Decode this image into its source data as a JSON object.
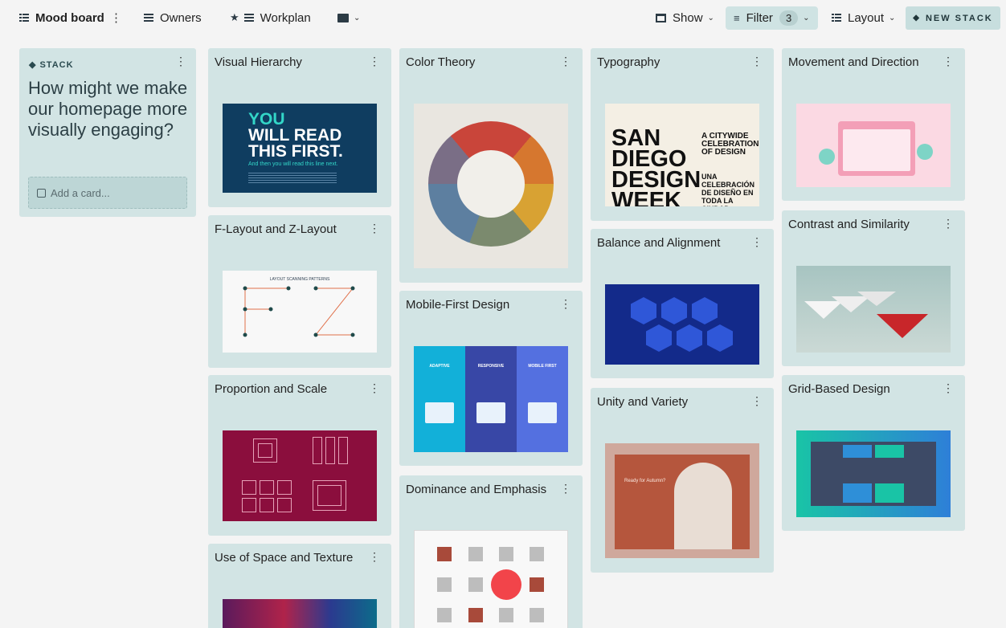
{
  "toolbar": {
    "board_title": "Mood board",
    "owners_label": "Owners",
    "workplan_label": "Workplan",
    "show_label": "Show",
    "filter_label": "Filter",
    "filter_count": "3",
    "layout_label": "Layout",
    "new_stack_label": "NEW STACK"
  },
  "stack": {
    "label": "STACK",
    "question": "How might we make our homepage more visually engaging?",
    "add_card_placeholder": "Add a card..."
  },
  "cards": {
    "visual_hierarchy": {
      "title": "Visual Hierarchy",
      "thumb": {
        "headline_accent": "YOU",
        "headline": "WILL READ THIS FIRST.",
        "subline": "And then you will read this line next."
      }
    },
    "f_z_layout": {
      "title": "F-Layout and Z-Layout",
      "thumb": {
        "heading": "LAYOUT SCANNING PATTERNS"
      }
    },
    "proportion_scale": {
      "title": "Proportion and Scale"
    },
    "space_texture": {
      "title": "Use of Space and Texture"
    },
    "color_theory": {
      "title": "Color Theory"
    },
    "mobile_first": {
      "title": "Mobile-First Design",
      "thumb": {
        "col1": "ADAPTIVE",
        "col2": "RESPONSIVE",
        "col3": "MOBILE FIRST"
      }
    },
    "dominance_emphasis": {
      "title": "Dominance and Emphasis"
    },
    "typography": {
      "title": "Typography",
      "thumb": {
        "big": "SAN DIEGO DESIGN WEEK",
        "right1": "A CITYWIDE CELEBRATION OF DESIGN",
        "right2": "UNA CELEBRACIÓN DE DISEÑO EN TODA LA CIUDAD"
      }
    },
    "balance_alignment": {
      "title": "Balance and Alignment"
    },
    "unity_variety": {
      "title": "Unity and Variety",
      "thumb": {
        "text": "Ready for Autumn?"
      }
    },
    "movement_direction": {
      "title": "Movement and Direction"
    },
    "contrast_similarity": {
      "title": "Contrast and Similarity"
    },
    "grid_layout": {
      "title": "Grid-Based Design"
    }
  }
}
